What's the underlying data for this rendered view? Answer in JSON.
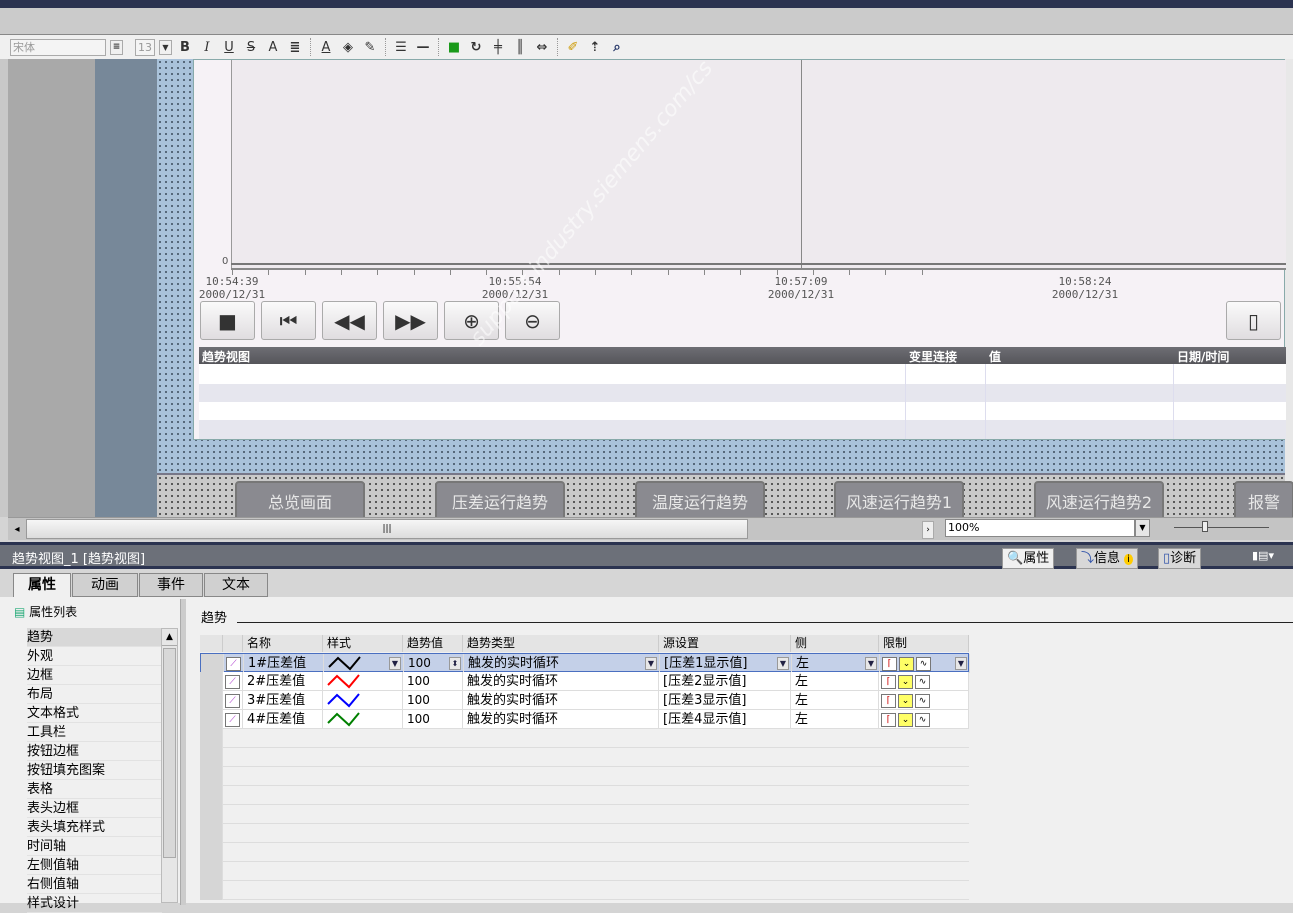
{
  "toolbar": {
    "font_name": "宋体",
    "font_size": "13",
    "bold": "B",
    "italic": "I",
    "underline": "U",
    "strike": "S",
    "grow": "A",
    "text_color": "A"
  },
  "trend_view": {
    "y_axis_zero": "0",
    "time_ticks": [
      {
        "time": "10:54:39",
        "date": "2000/12/31"
      },
      {
        "time": "10:55:54",
        "date": "2000/12/31"
      },
      {
        "time": "10:57:09",
        "date": "2000/12/31"
      },
      {
        "time": "10:58:24",
        "date": "2000/12/31"
      }
    ],
    "table_headers": [
      "趋势视图",
      "变里连接",
      "值",
      "日期/时间"
    ]
  },
  "nav_buttons": [
    "总览画面",
    "压差运行趋势",
    "温度运行趋势",
    "风速运行趋势1",
    "风速运行趋势2",
    "报警"
  ],
  "zoom": "100%",
  "watermark": "西门子工业 找答案 support.industry.siemens.com/cs",
  "inspector": {
    "title": "趋势视图_1 [趋势视图]",
    "right_tabs": [
      "属性",
      "信息",
      "诊断"
    ],
    "tabs": [
      "属性",
      "动画",
      "事件",
      "文本"
    ],
    "property_list_label": "属性列表",
    "section_title": "趋势",
    "categories": [
      "趋势",
      "外观",
      "边框",
      "布局",
      "文本格式",
      "工具栏",
      "按钮边框",
      "按钮填充图案",
      "表格",
      "表头边框",
      "表头填充样式",
      "时间轴",
      "左侧值轴",
      "右侧值轴",
      "样式设计"
    ],
    "columns": [
      "名称",
      "样式",
      "趋势值",
      "趋势类型",
      "源设置",
      "侧",
      "限制"
    ],
    "rows": [
      {
        "name": "1#压差值",
        "color": "#000000",
        "value": "100",
        "type": "触发的实时循环",
        "source": "[压差1显示值]",
        "side": "左"
      },
      {
        "name": "2#压差值",
        "color": "#ff0000",
        "value": "100",
        "type": "触发的实时循环",
        "source": "[压差2显示值]",
        "side": "左"
      },
      {
        "name": "3#压差值",
        "color": "#0000ff",
        "value": "100",
        "type": "触发的实时循环",
        "source": "[压差3显示值]",
        "side": "左"
      },
      {
        "name": "4#压差值",
        "color": "#008000",
        "value": "100",
        "type": "触发的实时循环",
        "source": "[压差4显示值]",
        "side": "左"
      }
    ]
  }
}
